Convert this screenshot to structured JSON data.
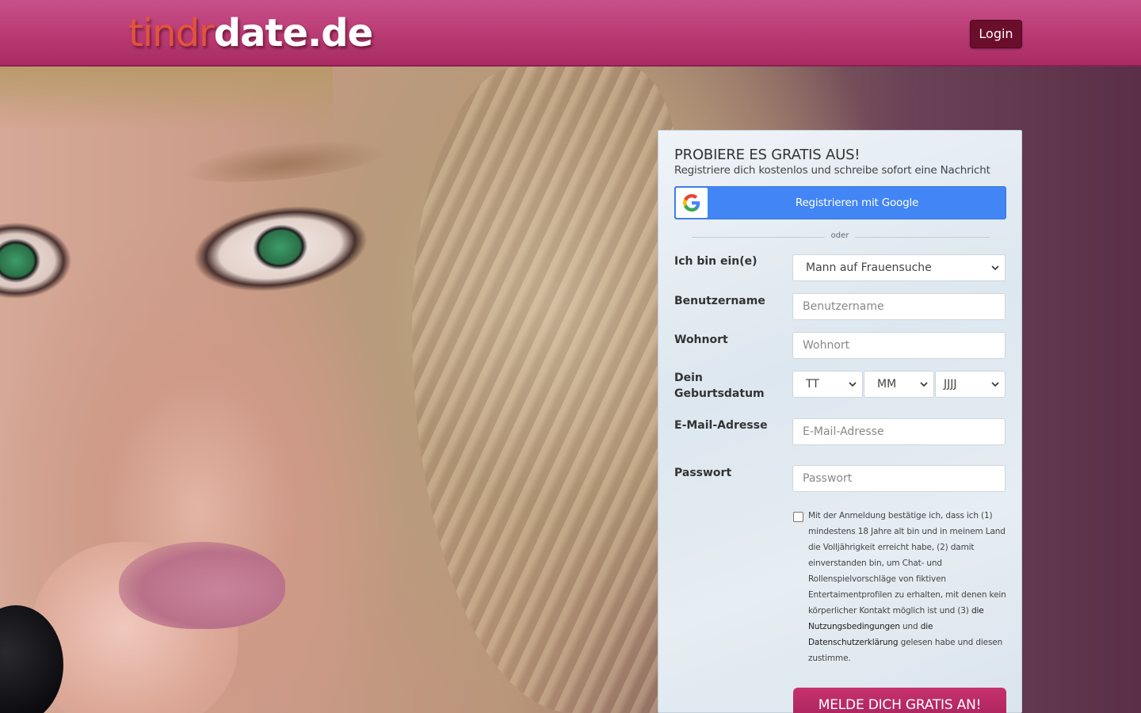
{
  "header": {
    "logo_part1": "tindr",
    "logo_part2": "date.de",
    "login_label": "Login"
  },
  "hero": {
    "description_icon": "woman-portrait-image"
  },
  "form": {
    "title": "PROBIERE ES GRATIS AUS!",
    "subtitle": "Registriere dich kostenlos und schreibe sofort eine Nachricht",
    "google_button_label": "Registrieren mit Google",
    "google_icon": "google-g-icon",
    "divider_text": "oder",
    "gender_label": "Ich bin ein(e)",
    "gender_value": "Mann auf Frauensuche",
    "username_label": "Benutzername",
    "username_placeholder": "Benutzername",
    "location_label": "Wohnort",
    "location_placeholder": "Wohnort",
    "birthdate_label_line1": "Dein",
    "birthdate_label_line2": "Geburtsdatum",
    "day_value": "TT",
    "month_value": "MM",
    "year_value": "JJJJ",
    "email_label": "E-Mail-Adresse",
    "email_placeholder": "E-Mail-Adresse",
    "password_label": "Passwort",
    "password_placeholder": "Passwort",
    "consent": {
      "text_before": "Mit der Anmeldung bestätige ich, dass ich (1) mindestens 18 Jahre alt bin und in meinem Land die Volljährigkeit erreicht habe, (2) damit einverstanden bin, um Chat- und Rollenspielvorschläge von fiktiven Entertaimentprofilen zu erhalten, mit denen kein körperlicher Kontakt möglich ist und (3) ",
      "terms_link": "die Nutzungsbedingungen",
      "text_middle": " und ",
      "privacy_link": "die Datenschutzerklärung",
      "text_after": " gelesen habe und diesen zustimme.",
      "checked": false
    },
    "submit_label": "MELDE DICH GRATIS AN!"
  },
  "colors": {
    "header": "#b93a73",
    "login_button": "#6b0e2b",
    "google_button": "#4285f4",
    "submit_button": "#b82763",
    "logo_accent": "#e2543b"
  }
}
